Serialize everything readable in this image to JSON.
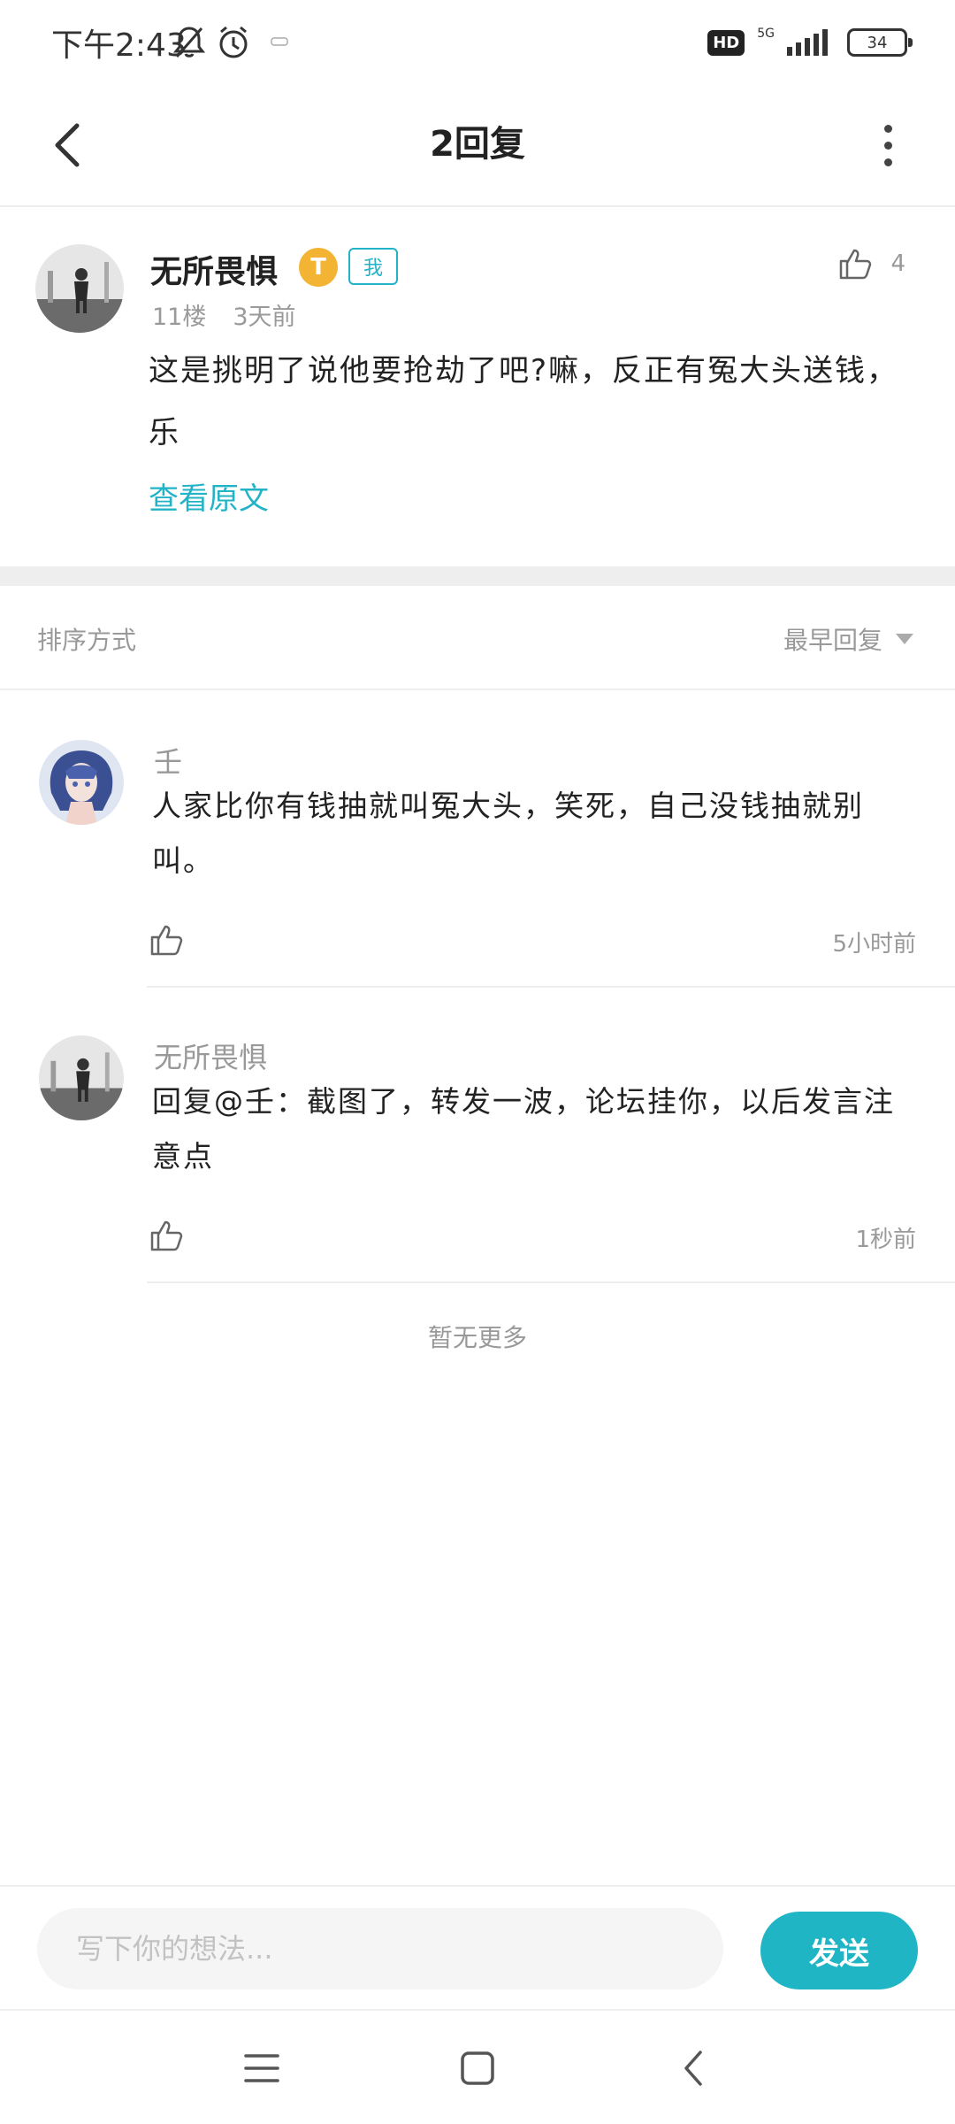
{
  "status_bar": {
    "time": "下午2:43",
    "network": "5G",
    "hd": "HD",
    "battery": "34"
  },
  "header": {
    "title": "2回复"
  },
  "post": {
    "author": "无所畏惧",
    "level_badge": "T",
    "me_badge": "我",
    "floor": "11楼",
    "time_ago": "3天前",
    "like_count": "4",
    "content": "这是挑明了说他要抢劫了吧?嘛，反正有冤大头送钱，乐",
    "view_original": "查看原文"
  },
  "sort": {
    "label": "排序方式",
    "value": "最早回复"
  },
  "replies": [
    {
      "author": "壬",
      "text": "人家比你有钱抽就叫冤大头，笑死，自己没钱抽就别叫。",
      "time": "5小时前"
    },
    {
      "author": "无所畏惧",
      "text": "回复@壬：截图了，转发一波，论坛挂你，以后发言注意点",
      "time": "1秒前"
    }
  ],
  "no_more": "暂无更多",
  "input": {
    "placeholder": "写下你的想法...",
    "send_label": "发送"
  },
  "colors": {
    "accent": "#1fb5c5",
    "level_badge": "#f3b333",
    "divider": "#eeeeee"
  },
  "icons": {
    "back": "chevron-left-icon",
    "more": "more-vertical-icon",
    "like": "thumbs-up-icon",
    "sort": "caret-down-icon",
    "nav_menu": "menu-icon",
    "nav_home": "square-icon",
    "nav_back": "chevron-left-icon"
  }
}
